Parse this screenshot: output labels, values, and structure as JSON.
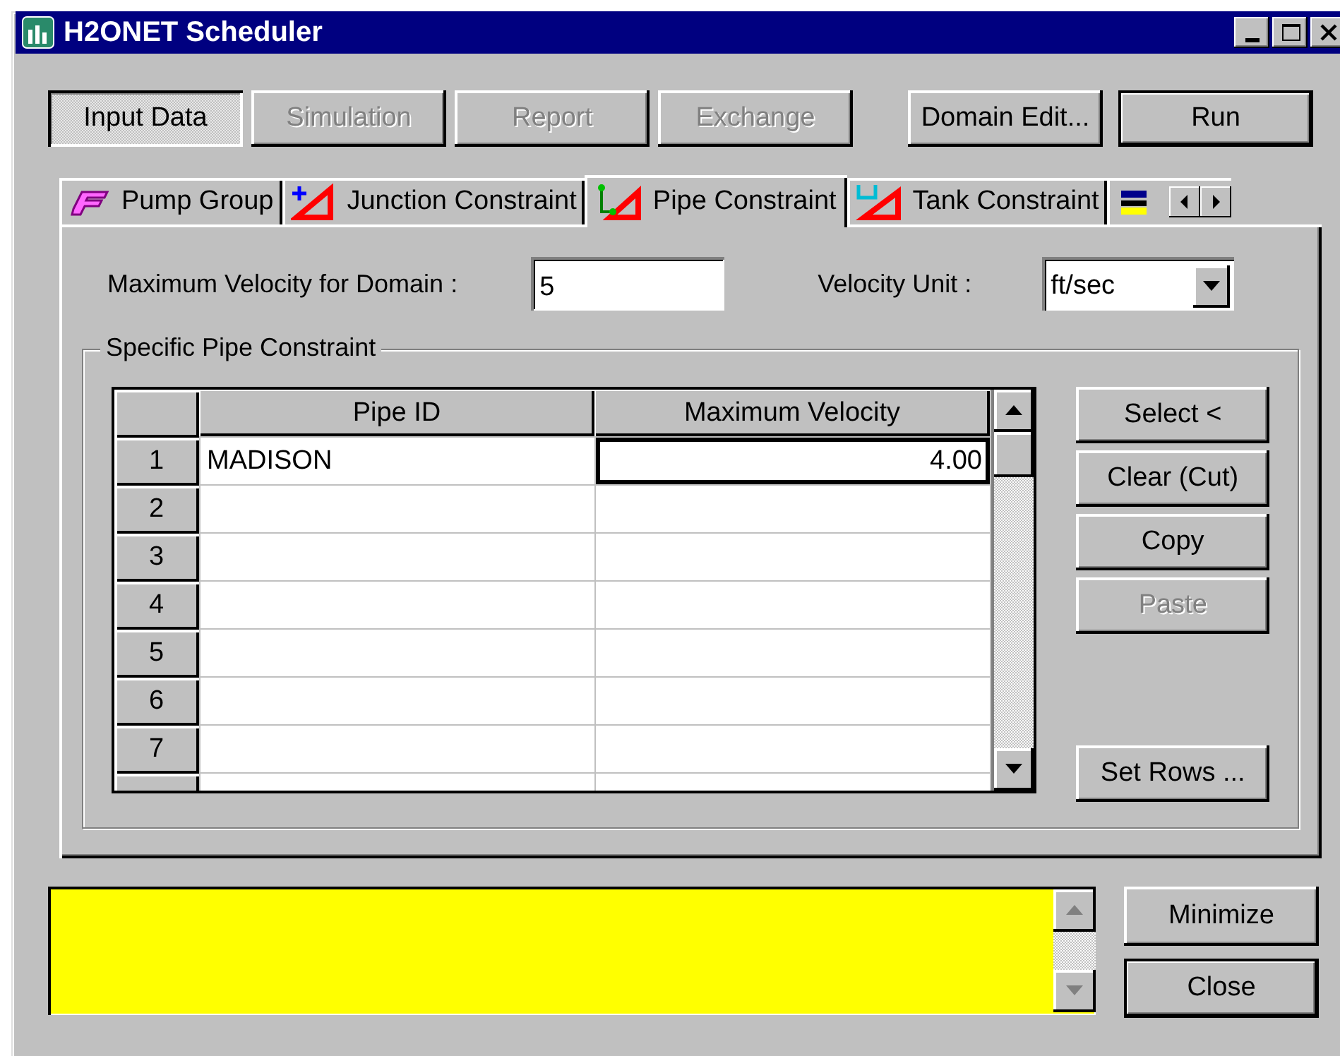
{
  "window": {
    "title": "H2ONET Scheduler"
  },
  "mode_buttons": [
    {
      "label": "Input Data",
      "selected": true,
      "disabled": false
    },
    {
      "label": "Simulation",
      "selected": false,
      "disabled": true
    },
    {
      "label": "Report",
      "selected": false,
      "disabled": true
    },
    {
      "label": "Exchange",
      "selected": false,
      "disabled": true
    }
  ],
  "action_buttons": [
    {
      "label": "Domain Edit...",
      "default": false
    },
    {
      "label": "Run",
      "default": true
    }
  ],
  "tabs": [
    {
      "label": "Pump Group",
      "kind": "pump",
      "selected": false
    },
    {
      "label": "Junction Constraint",
      "kind": "junction",
      "selected": false
    },
    {
      "label": "Pipe Constraint",
      "kind": "pipe",
      "selected": true
    },
    {
      "label": "Tank Constraint",
      "kind": "tank",
      "selected": false
    }
  ],
  "velocity": {
    "label": "Maximum Velocity for Domain :",
    "value": "5"
  },
  "unit": {
    "label": "Velocity Unit :",
    "value": "ft/sec"
  },
  "group": {
    "title": "Specific Pipe Constraint"
  },
  "table": {
    "columns": [
      "Pipe ID",
      "Maximum Velocity"
    ],
    "rows": [
      {
        "number": "1",
        "cells": [
          {
            "text": "MADISON",
            "focused": false
          },
          {
            "text": "4.00",
            "focused": true
          }
        ]
      },
      {
        "number": "2"
      },
      {
        "number": "3"
      },
      {
        "number": "4"
      },
      {
        "number": "5"
      },
      {
        "number": "6"
      },
      {
        "number": "7"
      }
    ]
  },
  "side_buttons": [
    {
      "label": "Select <",
      "disabled": false,
      "kind": "edit"
    },
    {
      "label": "Clear (Cut)",
      "disabled": false,
      "kind": "edit"
    },
    {
      "label": "Copy",
      "disabled": false,
      "kind": "edit"
    },
    {
      "label": "Paste",
      "disabled": true,
      "kind": "edit"
    },
    {
      "label": "Set Rows ...",
      "disabled": false,
      "kind": "rows"
    }
  ],
  "bottom_buttons": [
    {
      "label": "Minimize",
      "default": false
    },
    {
      "label": "Close",
      "default": true
    }
  ]
}
